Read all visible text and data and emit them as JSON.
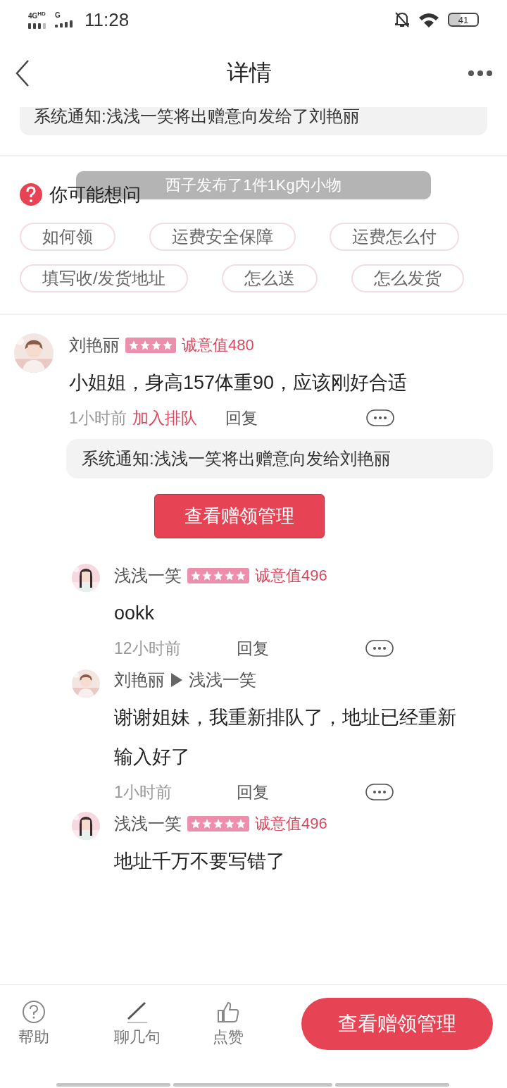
{
  "status_bar": {
    "network_1": "4G",
    "network_1_badge": "HD",
    "network_2": "G",
    "time": "11:28",
    "battery": "41"
  },
  "header": {
    "title": "详情"
  },
  "top_notice": "系统通知:浅浅一笑将出赠意向发给了刘艳丽",
  "toast": "西子发布了1件1Kg内小物",
  "faq": {
    "title": "你可能想问",
    "chips": [
      "如何领",
      "运费安全保障",
      "运费怎么付",
      "填写收/发货地址",
      "怎么送",
      "怎么发货"
    ]
  },
  "comment": {
    "author": "刘艳丽",
    "stars": 4,
    "sincerity": "诚意值480",
    "text": "小姐姐，身高157体重90，应该刚好合适",
    "time": "1小时前",
    "queue_link": "加入排队",
    "reply": "回复",
    "system_notice": "系统通知:浅浅一笑将出赠意向发给刘艳丽",
    "button": "查看赠领管理"
  },
  "replies": [
    {
      "kind": "rated",
      "author": "浅浅一笑",
      "stars": 5,
      "sincerity": "诚意值496",
      "text": "ookk",
      "time": "12小时前",
      "reply": "回复"
    },
    {
      "kind": "reply_to",
      "author": "刘艳丽",
      "target": "浅浅一笑",
      "text": "谢谢姐妹，我重新排队了，地址已经重新输入好了",
      "time": "1小时前",
      "reply": "回复"
    },
    {
      "kind": "rated",
      "author": "浅浅一笑",
      "stars": 5,
      "sincerity": "诚意值496",
      "text": "地址千万不要写错了"
    }
  ],
  "bottom_bar": {
    "items": [
      "帮助",
      "聊几句",
      "点赞"
    ],
    "button": "查看赠领管理"
  }
}
